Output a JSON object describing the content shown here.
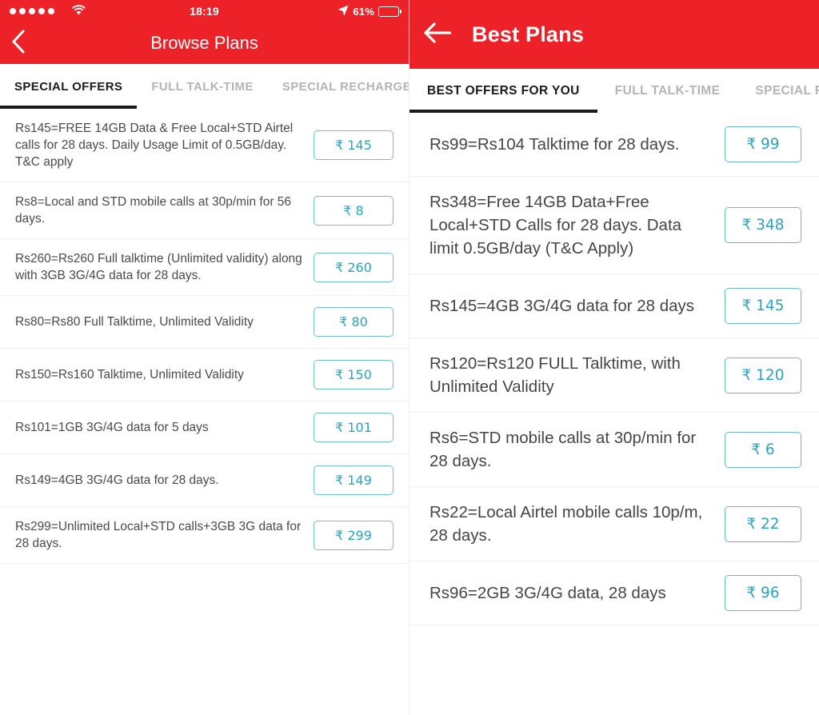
{
  "colors": {
    "brand_red": "#ED2228",
    "price_teal": "#2AA3C0",
    "price_border": "#6FBECB",
    "tab_active": "#1a1a1a",
    "tab_inactive": "#b4b4b4",
    "text_body": "#4a4a4a"
  },
  "left_panel": {
    "platform_icons": {
      "signal": "signal-dots-icon",
      "wifi": "wifi-icon",
      "location": "location-arrow-icon",
      "battery": "battery-icon",
      "back": "chevron-left-icon"
    },
    "statusbar": {
      "signal_dots": 5,
      "time": "18:19",
      "battery_percent": "61%",
      "battery_level": 61
    },
    "header": {
      "title": "Browse Plans"
    },
    "tabs": [
      {
        "label": "SPECIAL OFFERS",
        "active": true
      },
      {
        "label": "FULL TALK-TIME",
        "active": false
      },
      {
        "label": "SPECIAL RECHARGE",
        "active": false
      }
    ],
    "plans": [
      {
        "description": "Rs145=FREE 14GB Data & Free Local+STD Airtel calls for 28 days. Daily Usage Limit of 0.5GB/day. T&C apply",
        "price": "145",
        "price_label": "₹ 145"
      },
      {
        "description": "Rs8=Local and STD mobile calls at 30p/min for 56 days.",
        "price": "8",
        "price_label": "₹ 8"
      },
      {
        "description": "Rs260=Rs260 Full talktime (Unlimited validity) along with 3GB 3G/4G data for 28 days.",
        "price": "260",
        "price_label": "₹ 260"
      },
      {
        "description": "Rs80=Rs80 Full Talktime, Unlimited Validity",
        "price": "80",
        "price_label": "₹ 80"
      },
      {
        "description": "Rs150=Rs160 Talktime, Unlimited Validity",
        "price": "150",
        "price_label": "₹ 150"
      },
      {
        "description": "Rs101=1GB 3G/4G data for 5 days",
        "price": "101",
        "price_label": "₹ 101"
      },
      {
        "description": "Rs149=4GB 3G/4G data for 28 days.",
        "price": "149",
        "price_label": "₹ 149"
      },
      {
        "description": "Rs299=Unlimited Local+STD calls+3GB 3G data for 28 days.",
        "price": "299",
        "price_label": "₹ 299"
      }
    ]
  },
  "right_panel": {
    "platform_icons": {
      "back": "arrow-left-icon"
    },
    "header": {
      "title": "Best Plans"
    },
    "tabs": [
      {
        "label": "BEST OFFERS FOR YOU",
        "active": true
      },
      {
        "label": "FULL TALK-TIME",
        "active": false
      },
      {
        "label": "SPECIAL RECHARGE",
        "active": false
      }
    ],
    "plans": [
      {
        "description": "Rs99=Rs104 Talktime for 28 days.",
        "price": "99",
        "price_label": "₹ 99"
      },
      {
        "description": "Rs348=Free 14GB Data+Free Local+STD Calls for 28 days. Data limit 0.5GB/day (T&C Apply)",
        "price": "348",
        "price_label": "₹ 348"
      },
      {
        "description": "Rs145=4GB 3G/4G data for 28 days",
        "price": "145",
        "price_label": "₹ 145"
      },
      {
        "description": "Rs120=Rs120 FULL Talktime, with Unlimited Validity",
        "price": "120",
        "price_label": "₹ 120"
      },
      {
        "description": "Rs6=STD mobile calls at 30p/min for 28 days.",
        "price": "6",
        "price_label": "₹ 6"
      },
      {
        "description": "Rs22=Local Airtel mobile calls 10p/m, 28 days.",
        "price": "22",
        "price_label": "₹ 22"
      },
      {
        "description": "Rs96=2GB 3G/4G data, 28 days",
        "price": "96",
        "price_label": "₹ 96"
      }
    ]
  }
}
